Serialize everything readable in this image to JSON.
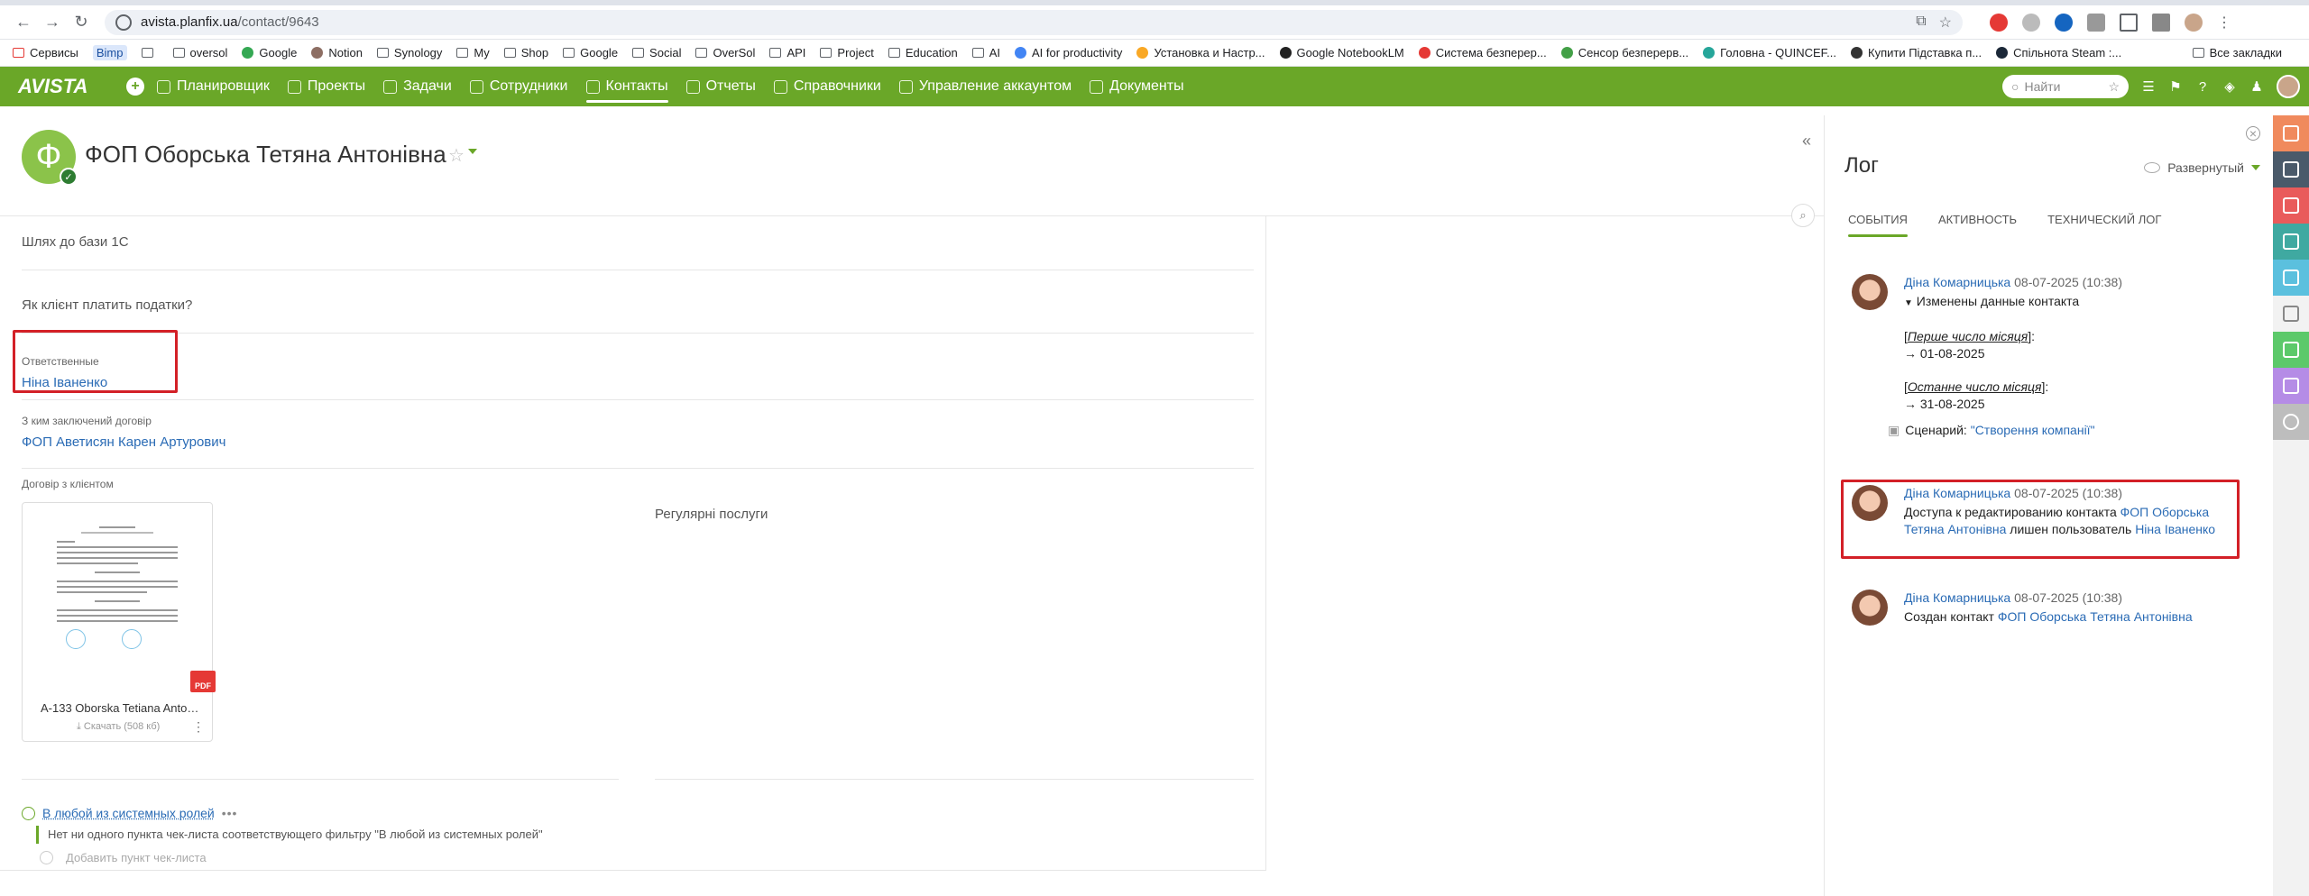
{
  "browser": {
    "url_host": "avista.planfix.ua",
    "url_path": "/contact/9643",
    "bookmarks": [
      "Сервисы",
      "Bimp",
      "",
      "oversol",
      "Google",
      "Notion",
      "Synology",
      "My",
      "Shop",
      "Google",
      "Social",
      "OverSol",
      "API",
      "Project",
      "Education",
      "AI",
      "AI for productivity",
      "Установка и Настр...",
      "Google NotebookLM",
      "Система безперер...",
      "Сенсор безперерв...",
      "Головна - QUINCEF...",
      "Купити Підставка п...",
      "Спільнота Steam :..."
    ],
    "bookmarks_all": "Все закладки"
  },
  "app": {
    "logo": "AVISTA",
    "nav": [
      "Планировщик",
      "Проекты",
      "Задачи",
      "Сотрудники",
      "Контакты",
      "Отчеты",
      "Справочники",
      "Управление аккаунтом",
      "Документы"
    ],
    "active_nav": "Контакты",
    "search_placeholder": "Найти"
  },
  "contact": {
    "initial": "Ф",
    "name": "ФОП Оборська Тетяна Антонівна",
    "fields": {
      "db_path_label": "Шлях до бази 1С",
      "tax_label": "Як клієнт платить податки?",
      "responsible_label": "Ответственные",
      "responsible_value": "Ніна Іваненко",
      "contract_with_label": "З ким заключений договір",
      "contract_with_value": "ФОП Аветисян Карен Артурович",
      "contract_label": "Договір з клієнтом",
      "services_label": "Регулярні послуги"
    },
    "document": {
      "name": "А-133 Oborska Tetiana Antoniv...",
      "download": "Скачать",
      "size": "(508 кб)",
      "type": "PDF"
    },
    "checklist": {
      "title": "В любой из системных ролей",
      "empty": "Нет ни одного пункта чек-листа соответствующего фильтру \"В любой из системных ролей\"",
      "add": "Добавить пункт чек-листа"
    }
  },
  "log": {
    "title": "Лог",
    "mode": "Развернутый",
    "tabs": [
      "СОБЫТИЯ",
      "АКТИВНОСТЬ",
      "ТЕХНИЧЕСКИЙ ЛОГ"
    ],
    "entries": [
      {
        "author": "Діна Комарницька",
        "date": "08-07-2025 (10:38)",
        "summary": "Изменены данные контакта",
        "f1_name": "Перше число місяця",
        "f1_value": "→ 01-08-2025",
        "f2_name": "Останне число місяця",
        "f2_value": "→ 31-08-2025",
        "scenario_label": "Сценарий:",
        "scenario_value": "\"Створення компанії\""
      },
      {
        "author": "Діна Комарницька",
        "date": "08-07-2025 (10:38)",
        "text_a": "Доступа к редактированию контакта",
        "link_a": "ФОП Оборська Тетяна Антонівна",
        "text_b": "лишен пользователь",
        "link_b": "Ніна Іваненко"
      },
      {
        "author": "Діна Комарницька",
        "date": "08-07-2025 (10:38)",
        "text_a": "Создан контакт",
        "link_a": "ФОП Оборська Тетяна Антонівна"
      }
    ]
  },
  "colors": {
    "brand": "#6aa728",
    "link": "#2a6bb5",
    "highlight": "#d32027"
  },
  "sidebar_icons": [
    "comment-icon",
    "contact-card-icon",
    "task-icon",
    "inbox-icon",
    "docs-icon",
    "clipboard-icon",
    "key-icon",
    "chart-icon",
    "minus-circle-icon"
  ]
}
